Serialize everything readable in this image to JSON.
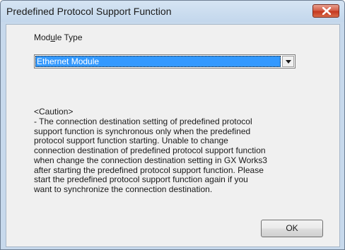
{
  "window": {
    "title": "Predefined Protocol Support Function"
  },
  "module_type": {
    "label_prefix": "Mod",
    "label_accel": "u",
    "label_suffix": "le Type",
    "selected": "Ethernet Module"
  },
  "caution": {
    "title": "<Caution>",
    "lines": [
      "- The connection destination setting of predefined protocol",
      "support function is synchronous only when the predefined",
      "protocol support function starting. Unable to change",
      "connection destination of predefined protocol support function",
      "when change the connection destination setting in GX Works3",
      "after starting the predefined protocol support function. Please",
      "start the predefined protocol support function again if you",
      "want to synchronize the connection destination."
    ]
  },
  "buttons": {
    "ok": "OK"
  },
  "icons": {
    "close": "close-icon",
    "dropdown": "chevron-down-icon"
  },
  "colors": {
    "titlebar": "#c7d9ec",
    "selection": "#3399ff",
    "close_button": "#c5381f"
  }
}
